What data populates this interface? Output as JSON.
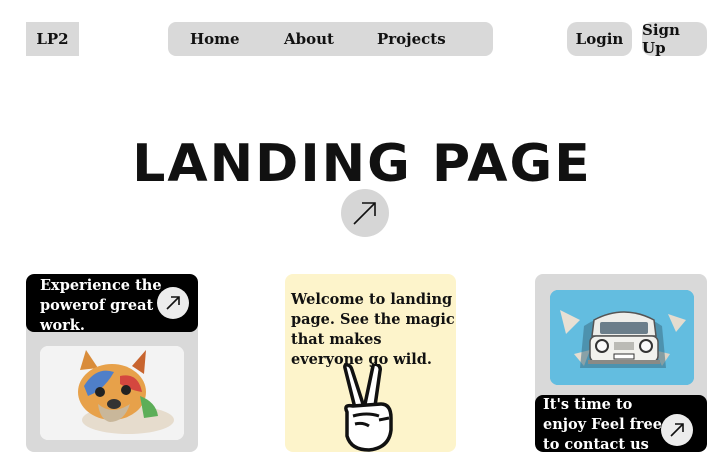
{
  "header": {
    "logo": "LP2",
    "nav": {
      "home": "Home",
      "about": "About",
      "projects": "Projects"
    },
    "login": "Login",
    "signup": "Sign Up"
  },
  "hero": {
    "title": "LANDING PAGE"
  },
  "cards": {
    "left": {
      "text": "Experience the powerof great work."
    },
    "middle": {
      "text": "Welcome to landing page. See the magic that makes everyone go wild."
    },
    "right": {
      "text": "It's time to enjoy Feel free to contact us"
    }
  },
  "colors": {
    "panel_gray": "#d9d9d9",
    "banner_black": "#000000",
    "cream": "#fdf4cb",
    "sky_blue": "#5fb7d9"
  },
  "icons": [
    "arrow-up-right-icon",
    "peace-hand-icon"
  ]
}
